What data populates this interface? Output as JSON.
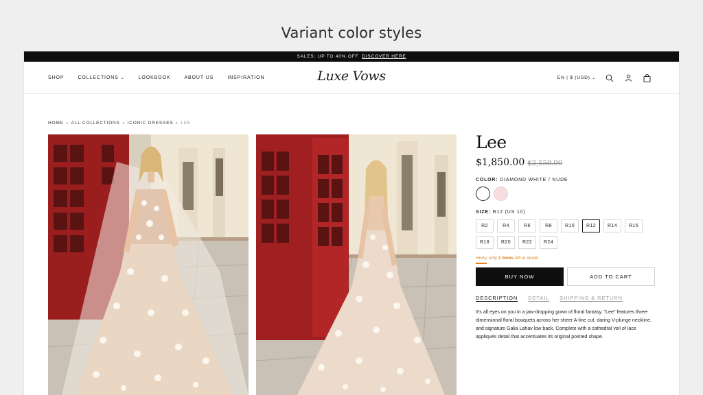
{
  "caption": "Variant color styles",
  "announcement": {
    "text": "SALES: UP TO 40% OFF",
    "link": "DISCOVER HERE"
  },
  "nav": [
    "SHOP",
    "COLLECTIONS",
    "LOOKBOOK",
    "ABOUT US",
    "INSPIRATION"
  ],
  "logo": "Luxe Vows",
  "locale": "EN | $ (USD)",
  "icons": {
    "search": "search-icon",
    "account": "user-icon",
    "cart": "bag-icon"
  },
  "breadcrumb": [
    "HOME",
    "ALL COLLECTIONS",
    "ICONIC DRESSES",
    "LEE"
  ],
  "product": {
    "title": "Lee",
    "price": "$1,850.00",
    "compare_price": "$2,550.00",
    "color_label": "COLOR:",
    "color_value": "DIAMOND WHITE / NUDE",
    "swatch_colors": [
      "#ffffff",
      "#f7dde0"
    ],
    "size_label": "SIZE:",
    "size_value": "R12 (US 10)",
    "sizes": [
      "R2",
      "R4",
      "R6",
      "R8",
      "R10",
      "R12",
      "R14",
      "R15",
      "R18",
      "R20",
      "R22",
      "R24"
    ],
    "selected_size": "R12",
    "stock_prefix": "Hurry, only",
    "stock_count": "2 items",
    "stock_suffix": "left in stock!",
    "buy_now": "BUY NOW",
    "add_to_cart": "ADD TO CART",
    "tabs": [
      "DESCRIPTION",
      "DETAIL",
      "SHIPPING & RETURN"
    ],
    "description": "It's all eyes on you in a jaw-dropping gown of floral fantasy. \"Lee\" features three-dimensional floral bouquets across her sheer A-line cut, daring V-plunge neckline, and signature Galia Lahav low back. Complete with a cathedral veil of lace appliqués detail that accentuates its original pointed shape."
  },
  "colors": {
    "accent_stock": "#e0811f",
    "button_dark": "#0f0f0f"
  }
}
